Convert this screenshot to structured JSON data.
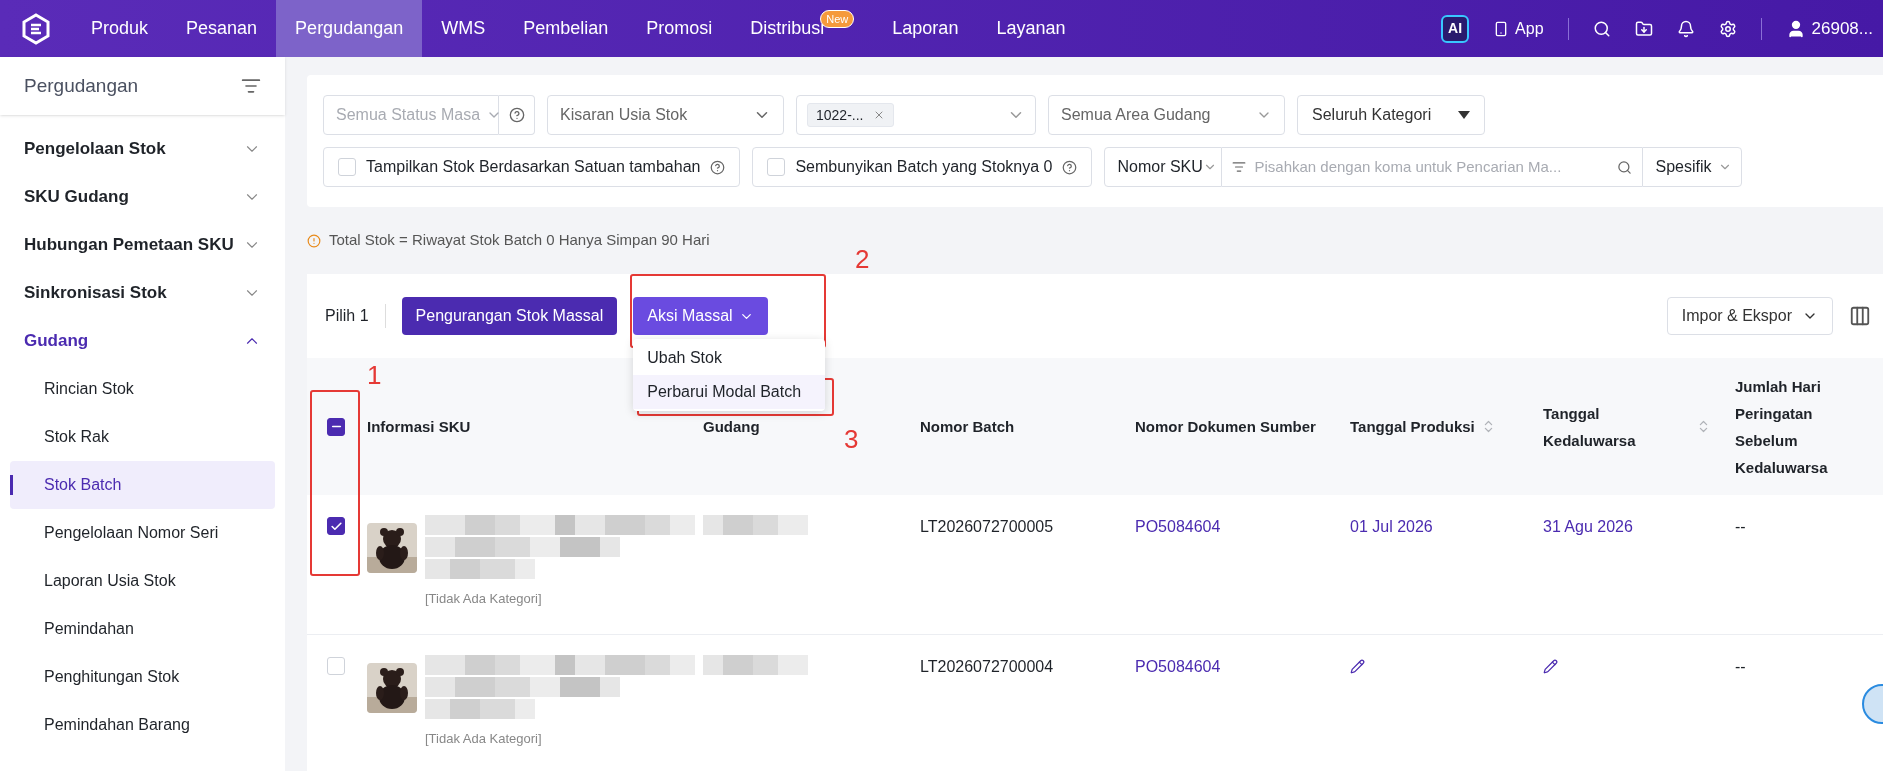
{
  "top_nav": {
    "items": [
      {
        "label": "Produk",
        "selected": false
      },
      {
        "label": "Pesanan",
        "selected": false
      },
      {
        "label": "Pergudangan",
        "selected": true
      },
      {
        "label": "WMS",
        "selected": false
      },
      {
        "label": "Pembelian",
        "selected": false
      },
      {
        "label": "Promosi",
        "selected": false
      },
      {
        "label": "Distribusi",
        "selected": false,
        "badge": "New"
      },
      {
        "label": "Laporan",
        "selected": false
      },
      {
        "label": "Layanan",
        "selected": false
      }
    ],
    "ai_label": "AI",
    "app_label": "App",
    "user": "26908..."
  },
  "sidebar": {
    "title": "Pergudangan",
    "items": [
      {
        "label": "Pengelolaan Stok",
        "expanded": false,
        "selected": false
      },
      {
        "label": "SKU Gudang",
        "expanded": false,
        "selected": false
      },
      {
        "label": "Hubungan Pemetaan SKU",
        "expanded": false,
        "selected": false
      },
      {
        "label": "Sinkronisasi Stok",
        "expanded": false,
        "selected": false
      },
      {
        "label": "Gudang",
        "expanded": true,
        "selected": true,
        "children": [
          {
            "label": "Rincian Stok",
            "selected": false
          },
          {
            "label": "Stok Rak",
            "selected": false
          },
          {
            "label": "Stok Batch",
            "selected": true
          },
          {
            "label": "Pengelolaan Nomor Seri",
            "selected": false
          },
          {
            "label": "Laporan Usia Stok",
            "selected": false
          },
          {
            "label": "Pemindahan",
            "selected": false
          },
          {
            "label": "Penghitungan Stok",
            "selected": false
          },
          {
            "label": "Pemindahan Barang",
            "selected": false
          }
        ]
      }
    ]
  },
  "filters": {
    "status_placeholder": "Semua Status Masa",
    "age_placeholder": "Kisaran Usia Stok",
    "batch_tag": "1022-...",
    "area_placeholder": "Semua Area Gudang",
    "category": "Seluruh Kategori",
    "checkboxes": [
      {
        "label": "Tampilkan Stok Berdasarkan Satuan tambahan",
        "checked": false
      },
      {
        "label": "Sembunyikan Batch yang Stoknya 0",
        "checked": false
      }
    ],
    "search_field": "Nomor SKU",
    "search_placeholder": "Pisahkan dengan koma untuk Pencarian Ma...",
    "search_mode": "Spesifik"
  },
  "notice": "Total Stok = Riwayat Stok Batch 0 Hanya Simpan 90 Hari",
  "toolbar": {
    "selected_count": "Pilih 1",
    "reduce_button": "Pengurangan Stok Massal",
    "bulk_button": "Aksi Massal",
    "bulk_menu": [
      {
        "label": "Ubah Stok",
        "selected": false
      },
      {
        "label": "Perbarui Modal Batch",
        "selected": true
      }
    ],
    "import_export": "Impor & Ekspor"
  },
  "table": {
    "header_checkbox": {
      "checked": true,
      "indeterminate": true
    },
    "columns": [
      {
        "label": "Informasi SKU",
        "sortable": false
      },
      {
        "label": "Gudang",
        "sortable": false
      },
      {
        "label": "Nomor Batch",
        "sortable": false
      },
      {
        "label": "Nomor Dokumen Sumber",
        "sortable": false
      },
      {
        "label": "Tanggal Produksi",
        "sortable": true
      },
      {
        "label": "Tanggal Kedaluwarsa",
        "sortable": true
      },
      {
        "label": "Jumlah Hari Peringatan Sebelum Kedaluwarsa",
        "sortable": false
      }
    ],
    "rows": [
      {
        "checked": true,
        "category": "[Tidak Ada Kategori]",
        "batch": "LT2026072700005",
        "document": "PO5084604",
        "production_date": {
          "kind": "text",
          "text": "01 Jul 2026"
        },
        "expiry_date": {
          "kind": "text",
          "text": "31 Agu 2026"
        },
        "warning_days": "--"
      },
      {
        "checked": false,
        "category": "[Tidak Ada Kategori]",
        "batch": "LT2026072700004",
        "document": "PO5084604",
        "production_date": {
          "kind": "edit"
        },
        "expiry_date": {
          "kind": "edit"
        },
        "warning_days": "--"
      }
    ]
  },
  "annotations": [
    {
      "label": "1"
    },
    {
      "label": "2"
    },
    {
      "label": "3"
    }
  ]
}
